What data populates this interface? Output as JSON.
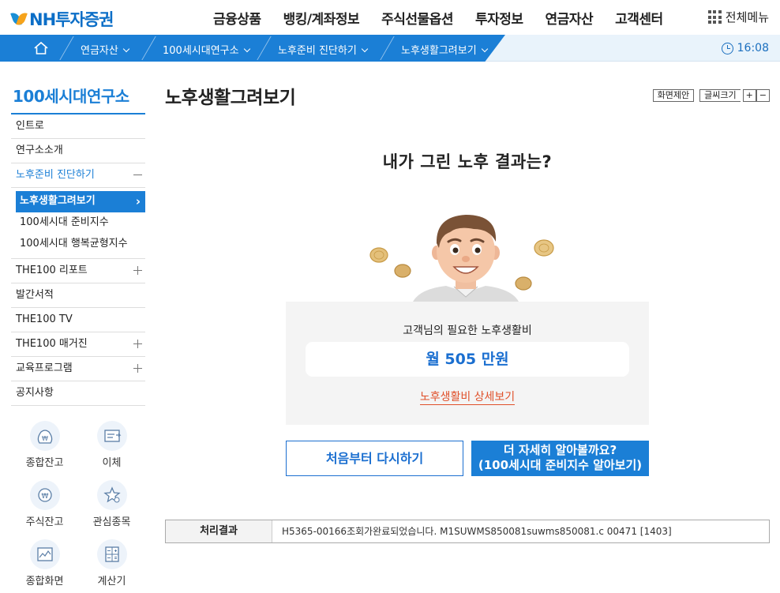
{
  "header": {
    "logo_text": "NH투자증권",
    "gnb": [
      "금융상품",
      "뱅킹/계좌정보",
      "주식선물옵션",
      "투자정보",
      "연금자산",
      "고객센터"
    ],
    "all_menu": "전체메뉴"
  },
  "breadcrumb": {
    "items": [
      "연금자산",
      "100세시대연구소",
      "노후준비 진단하기",
      "노후생활그려보기"
    ],
    "time": "16:08"
  },
  "sidebar": {
    "title": "100세시대연구소",
    "items": [
      {
        "label": "인트로"
      },
      {
        "label": "연구소소개"
      },
      {
        "label": "노후준비 진단하기"
      },
      {
        "label": "THE100 리포트"
      },
      {
        "label": "발간서적"
      },
      {
        "label": "THE100 TV"
      },
      {
        "label": "THE100 매거진"
      },
      {
        "label": "교육프로그램"
      },
      {
        "label": "공지사항"
      }
    ],
    "sub_items": [
      "노후생활그려보기",
      "100세시대 준비지수",
      "100세시대 행복균형지수"
    ]
  },
  "quick_menu": [
    "종합잔고",
    "이체",
    "주식잔고",
    "관심종목",
    "종합화면",
    "계산기"
  ],
  "main": {
    "title": "노후생활그려보기",
    "tools": {
      "suggest": "화면제안",
      "font_size": "글씨크기",
      "plus": "+",
      "minus": "−"
    },
    "question": "내가 그린 노후 결과는?",
    "cost_label": "고객님의 필요한 노후생활비",
    "cost_value": "월 505 만원",
    "detail_link": "노후생활비 상세보기",
    "restart_button": "처음부터 다시하기",
    "more_button_line1": "더 자세히 알아볼까요?",
    "more_button_line2": "(100세시대 준비지수 알아보기)"
  },
  "status_bar": {
    "label": "처리결과",
    "message": "H5365-00166조회가완료되었습니다. M1SUWMS850081suwms850081.c 00471 [1403]"
  },
  "colors": {
    "brand_blue": "#1b7fd6",
    "link_orange": "#e0502a"
  }
}
